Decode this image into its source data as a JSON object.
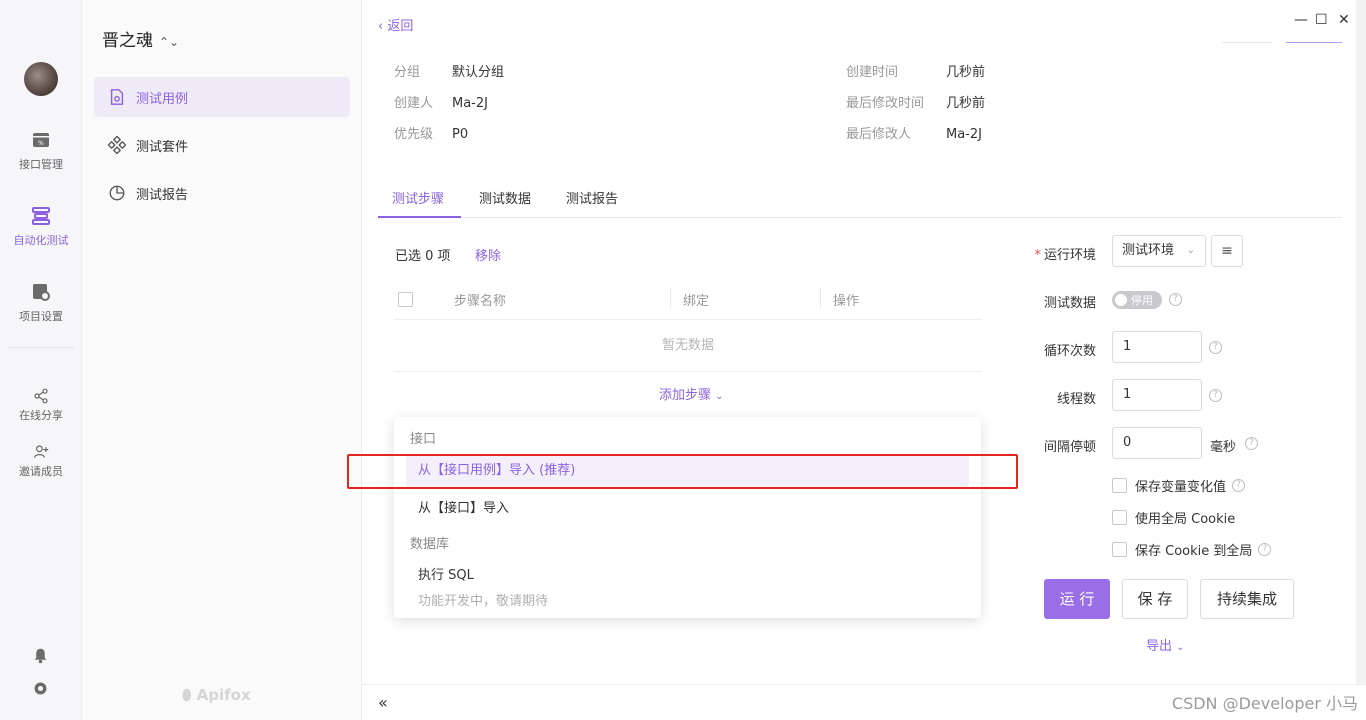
{
  "rail": {
    "items": [
      {
        "label": "接口管理",
        "icon": "api-icon"
      },
      {
        "label": "自动化测试",
        "icon": "automation-icon"
      },
      {
        "label": "项目设置",
        "icon": "settings-doc-icon"
      },
      {
        "label": "在线分享",
        "icon": "share-icon"
      },
      {
        "label": "邀请成员",
        "icon": "invite-icon"
      }
    ]
  },
  "nav": {
    "project": "晋之魂",
    "items": [
      {
        "label": "测试用例"
      },
      {
        "label": "测试套件"
      },
      {
        "label": "测试报告"
      }
    ],
    "logo": "Apifox"
  },
  "header": {
    "back": "返回"
  },
  "meta": {
    "group_k": "分组",
    "group_v": "默认分组",
    "creator_k": "创建人",
    "creator_v": "Ma-2J",
    "priority_k": "优先级",
    "priority_v": "P0",
    "created_k": "创建时间",
    "created_v": "几秒前",
    "modified_k": "最后修改时间",
    "modified_v": "几秒前",
    "modifier_k": "最后修改人",
    "modifier_v": "Ma-2J"
  },
  "tabs": [
    {
      "label": "测试步骤"
    },
    {
      "label": "测试数据"
    },
    {
      "label": "测试报告"
    }
  ],
  "steps": {
    "selected": "已选 0 项",
    "remove": "移除",
    "col_name": "步骤名称",
    "col_bind": "绑定",
    "col_op": "操作",
    "empty": "暂无数据",
    "add": "添加步骤"
  },
  "dropdown": {
    "group1": "接口",
    "item1": "从【接口用例】导入 (推荐)",
    "item2": "从【接口】导入",
    "group2": "数据库",
    "item3": "执行 SQL",
    "item3_sub": "功能开发中，敬请期待"
  },
  "settings": {
    "env_label": "运行环境",
    "env_value": "测试环境",
    "data_label": "测试数据",
    "data_switch": "停用",
    "loop_label": "循环次数",
    "loop_value": "1",
    "thread_label": "线程数",
    "thread_value": "1",
    "interval_label": "间隔停顿",
    "interval_value": "0",
    "interval_unit": "毫秒",
    "save_var": "保存变量变化值",
    "use_cookie": "使用全局 Cookie",
    "save_cookie": "保存 Cookie 到全局"
  },
  "actions": {
    "run": "运 行",
    "save": "保 存",
    "ci": "持续集成",
    "export": "导出"
  },
  "footer": {
    "watermark": "CSDN @Developer 小马"
  }
}
